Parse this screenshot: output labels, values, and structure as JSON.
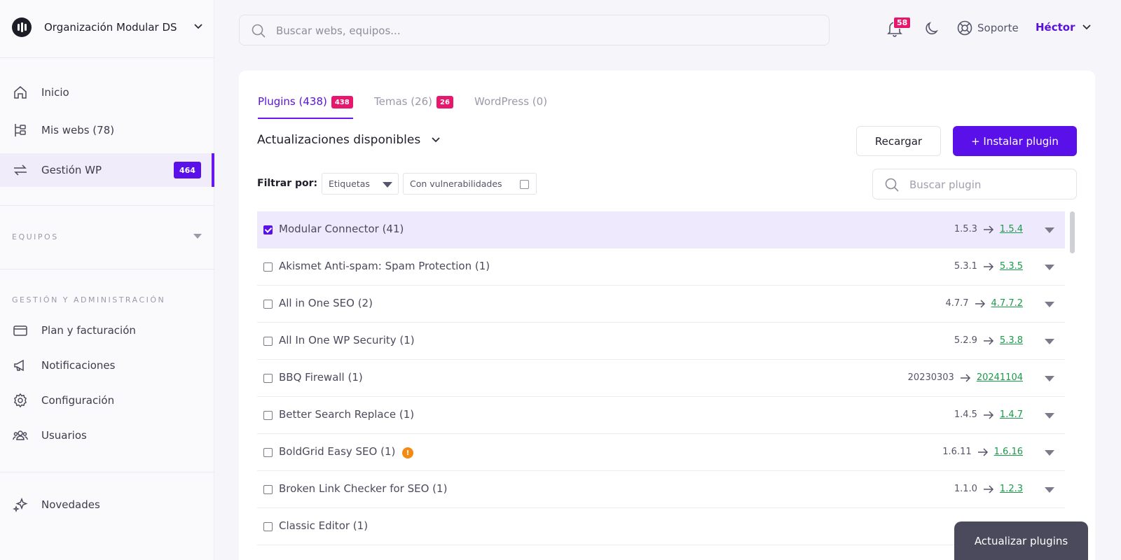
{
  "org": {
    "name": "Organización Modular DS"
  },
  "nav": {
    "home": "Inicio",
    "sites": "Mis webs (78)",
    "wp": "Gestión WP",
    "wp_badge": "464",
    "teams_title": "EQUIPOS",
    "admin_title": "GESTIÓN Y ADMINISTRACIÓN",
    "billing": "Plan y facturación",
    "notifications": "Notificaciones",
    "settings": "Configuración",
    "users": "Usuarios",
    "news": "Novedades"
  },
  "topbar": {
    "search_placeholder": "Buscar webs, equipos...",
    "notif_count": "58",
    "support": "Soporte",
    "user": "Héctor"
  },
  "tabs": {
    "plugins": {
      "label": "Plugins (438)",
      "badge": "438"
    },
    "themes": {
      "label": "Temas (26)",
      "badge": "26"
    },
    "wordpress": {
      "label": "WordPress (0)"
    }
  },
  "section": {
    "title": "Actualizaciones disponibles"
  },
  "buttons": {
    "reload": "Recargar",
    "install": "+ Instalar plugin",
    "update": "Actualizar plugins"
  },
  "filters": {
    "label": "Filtrar por:",
    "tags": "Etiquetas",
    "vuln": "Con vulnerabilidades",
    "search_placeholder": "Buscar plugin"
  },
  "plugins": [
    {
      "name": "Modular Connector (41)",
      "current": "1.5.3",
      "new": "1.5.4",
      "checked": true,
      "warn": false
    },
    {
      "name": "Akismet Anti-spam: Spam Protection (1)",
      "current": "5.3.1",
      "new": "5.3.5",
      "checked": false,
      "warn": false
    },
    {
      "name": "All in One SEO (2)",
      "current": "4.7.7",
      "new": "4.7.7.2",
      "checked": false,
      "warn": false
    },
    {
      "name": "All In One WP Security (1)",
      "current": "5.2.9",
      "new": "5.3.8",
      "checked": false,
      "warn": false
    },
    {
      "name": "BBQ Firewall (1)",
      "current": "20230303",
      "new": "20241104",
      "checked": false,
      "warn": false
    },
    {
      "name": "Better Search Replace (1)",
      "current": "1.4.5",
      "new": "1.4.7",
      "checked": false,
      "warn": false
    },
    {
      "name": "BoldGrid Easy SEO (1)",
      "current": "1.6.11",
      "new": "1.6.16",
      "checked": false,
      "warn": true
    },
    {
      "name": "Broken Link Checker for SEO (1)",
      "current": "1.1.0",
      "new": "1.2.3",
      "checked": false,
      "warn": false
    },
    {
      "name": "Classic Editor (1)",
      "current": "",
      "new": "",
      "checked": false,
      "warn": false
    }
  ],
  "colors": {
    "accent": "#5a10e8",
    "badge": "#e5186e",
    "update_green": "#1a9a4a",
    "warning": "#f28a14"
  }
}
